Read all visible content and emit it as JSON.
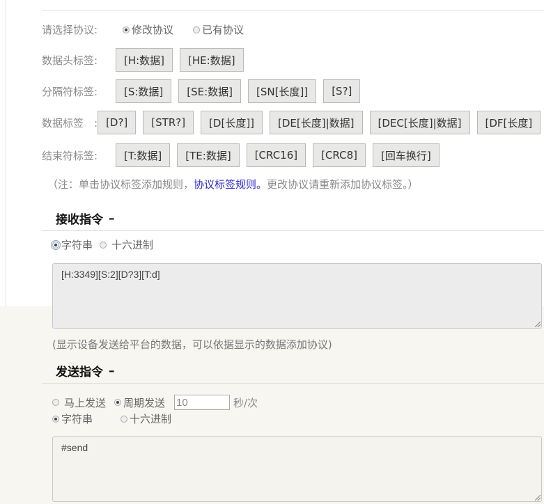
{
  "protocol": {
    "label": "请选择协议:",
    "options": [
      {
        "label": "修改协议",
        "selected": true
      },
      {
        "label": "已有协议",
        "selected": false
      }
    ]
  },
  "tag_rows": [
    {
      "label": "数据头标签:",
      "tags": [
        "[H:数据]",
        "[HE:数据]"
      ]
    },
    {
      "label": "分隔符标签:",
      "tags": [
        "[S:数据]",
        "[SE:数据]",
        "[SN[长度]]",
        "[S?]"
      ]
    },
    {
      "label": "数据标签　:",
      "tags": [
        "[D?]",
        "[STR?]",
        "[D[长度]]",
        "[DE[长度]|数据]",
        "[DEC[长度]|数据]",
        "[DF[长度]"
      ]
    },
    {
      "label": "结束符标签:",
      "tags": [
        "[T:数据]",
        "[TE:数据]",
        "[CRC16]",
        "[CRC8]",
        "[回车换行]"
      ]
    }
  ],
  "note": {
    "prefix": "（注：单击协议标签添加规则，",
    "link": "协议标签规则。",
    "suffix": "更改协议请重新添加协议标签。）"
  },
  "receive": {
    "title": "接收指令",
    "toggle": "–",
    "encoding": [
      {
        "label": "字符串",
        "selected": true
      },
      {
        "label": "十六进制",
        "selected": false
      }
    ],
    "content": "[H:3349][S:2][D?3][T:d]",
    "hint": "(显示设备发送给平台的数据，可以依据显示的数据添加协议)"
  },
  "send": {
    "title": "发送指令",
    "toggle": "–",
    "mode": [
      {
        "label": "马上发送",
        "selected": false
      },
      {
        "label": "周期发送",
        "selected": true
      }
    ],
    "period_value": "10",
    "period_unit": "秒/次",
    "encoding": [
      {
        "label": "字符串",
        "selected": true
      },
      {
        "label": "十六进制",
        "selected": false
      }
    ],
    "content": "#send"
  }
}
